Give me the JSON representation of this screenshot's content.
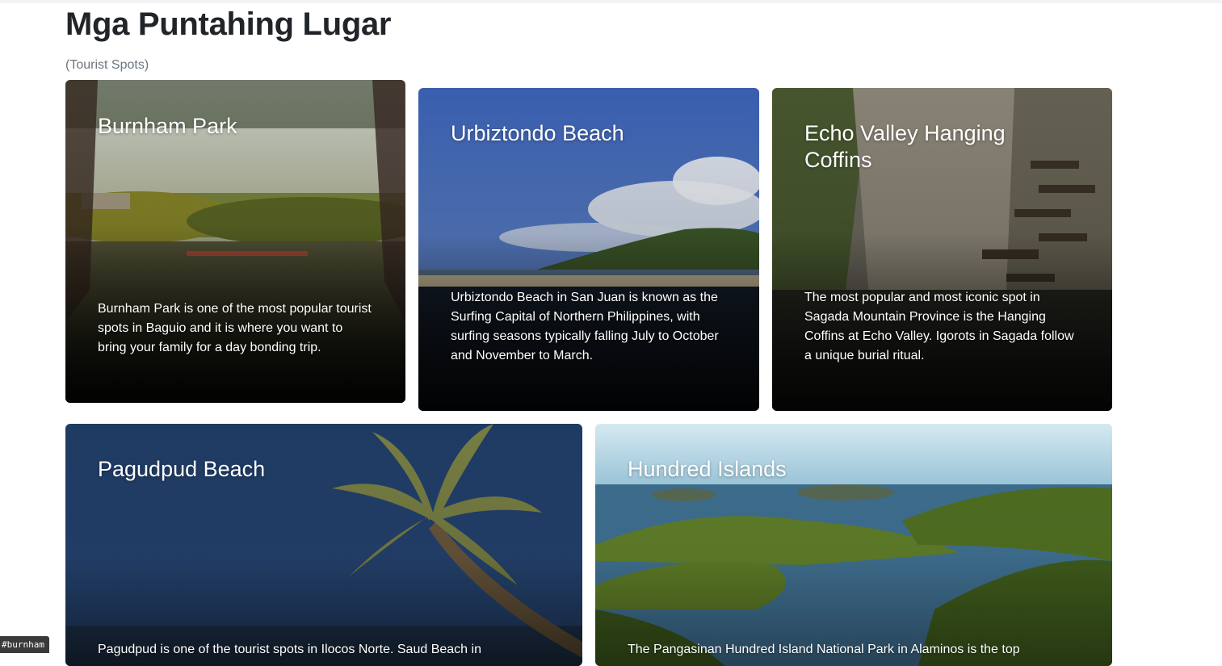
{
  "page": {
    "title": "Mga Puntahing Lugar",
    "subtitle": "(Tourist Spots)"
  },
  "cards": [
    {
      "title": "Burnham Park",
      "text": "Burnham Park is one of the most popular tourist spots in Baguio and it is where you want to bring your family for a day bonding trip."
    },
    {
      "title": "Urbiztondo Beach",
      "text": "Urbiztondo Beach in San Juan is known as the Surfing Capital of Northern Philippines, with surfing seasons typically falling July to October and November to March."
    },
    {
      "title": "Echo Valley Hanging Coffins",
      "text": "The most popular and most iconic spot in Sagada Mountain Province is the Hanging Coffins at Echo Valley. Igorots in Sagada follow a unique burial ritual."
    },
    {
      "title": "Pagudpud Beach",
      "text": "Pagudpud is one of the tourist spots in Ilocos Norte. Saud Beach in"
    },
    {
      "title": "Hundred Islands",
      "text": "The Pangasinan Hundred Island National Park in Alaminos is the top"
    }
  ],
  "tooltip": {
    "text": "#burnham"
  }
}
